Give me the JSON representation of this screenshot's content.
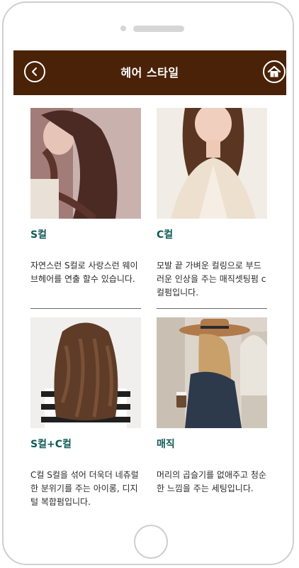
{
  "header": {
    "title": "헤어 스타일"
  },
  "cards": [
    {
      "title": "S컬",
      "desc": "자연스런 S컬로 사랑스런 웨이브헤어를 연출 할수 있습니다."
    },
    {
      "title": "C컬",
      "desc": "모발 끝 가벼운 컬링으로 부드러운 인상을 주는 매직셋팅펌 c컬펌입니다."
    },
    {
      "title": "S컬+C컬",
      "desc": "C컬 S컬을 섞어 더욱더 네츄럴한 분위기를 주는 아이롱, 디지털 복합펌입니다."
    },
    {
      "title": "매직",
      "desc": "머리의 곱슬기를 없애주고 청순한 느낌을 주는 세팅입니다."
    }
  ],
  "colors": {
    "header_bg": "#4a2208",
    "title_accent": "#0e5a58"
  },
  "icons": {
    "back": "chevron-left-icon",
    "home": "home-icon"
  }
}
